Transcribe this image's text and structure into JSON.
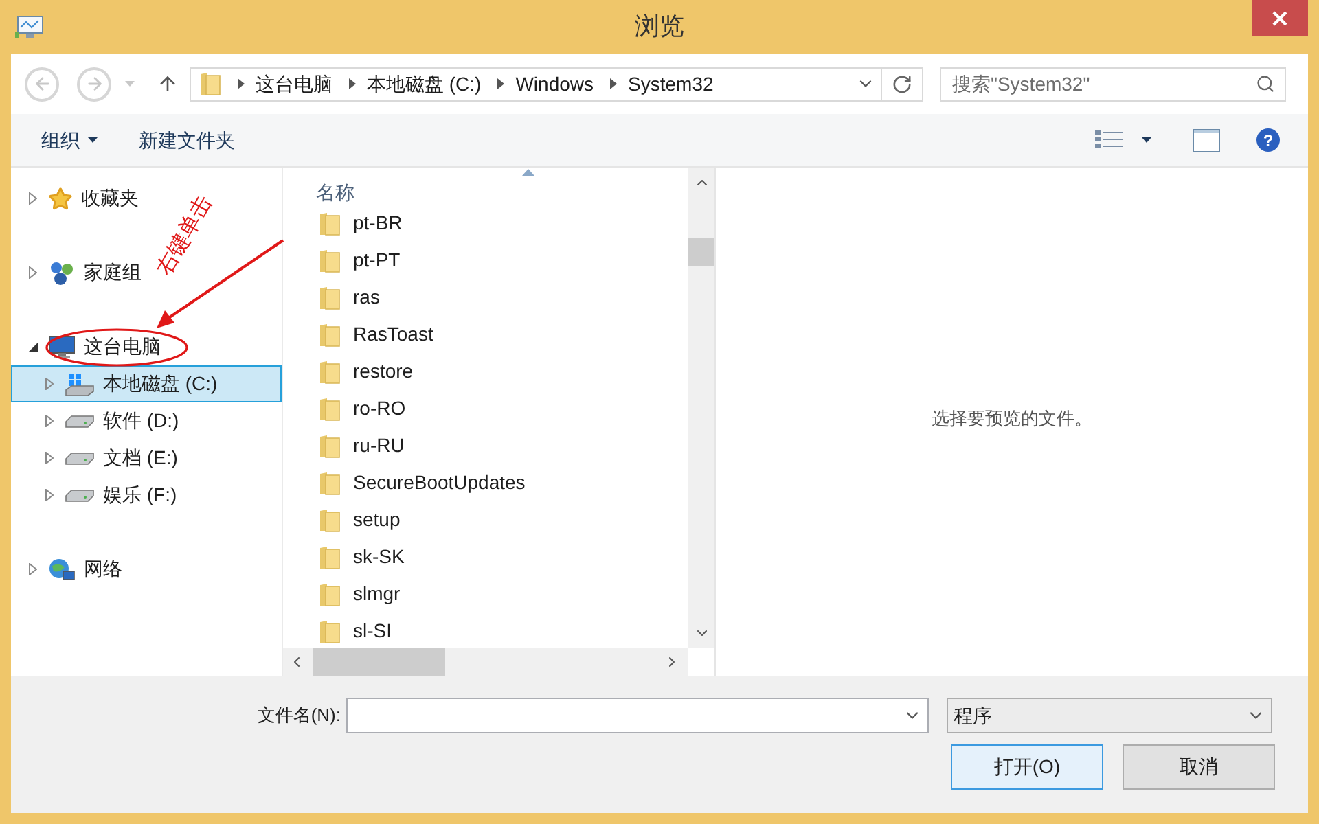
{
  "window": {
    "title": "浏览"
  },
  "navigation": {
    "breadcrumb": [
      "这台电脑",
      "本地磁盘 (C:)",
      "Windows",
      "System32"
    ],
    "search": {
      "placeholder": "搜索\"System32\""
    }
  },
  "toolbar": {
    "organize": "组织",
    "new_folder": "新建文件夹",
    "help": "?"
  },
  "tree": [
    {
      "kind": "favorites",
      "label": "收藏夹",
      "expanded": false,
      "selected": false
    },
    {
      "kind": "homegroup",
      "label": "家庭组",
      "expanded": false,
      "selected": false
    },
    {
      "kind": "computer",
      "label": "这台电脑",
      "expanded": true,
      "selected": false,
      "children": [
        {
          "kind": "system-drive",
          "label": "本地磁盘 (C:)",
          "expanded": false,
          "selected": true
        },
        {
          "kind": "drive",
          "label": "软件 (D:)",
          "expanded": false,
          "selected": false
        },
        {
          "kind": "drive",
          "label": "文档 (E:)",
          "expanded": false,
          "selected": false
        },
        {
          "kind": "drive",
          "label": "娱乐 (F:)",
          "expanded": false,
          "selected": false
        }
      ]
    },
    {
      "kind": "network",
      "label": "网络",
      "expanded": false,
      "selected": false
    }
  ],
  "annotation": {
    "text": "右键单击"
  },
  "file_list": {
    "column_header": "名称",
    "rows": [
      {
        "name": "pt-BR"
      },
      {
        "name": "pt-PT"
      },
      {
        "name": "ras"
      },
      {
        "name": "RasToast"
      },
      {
        "name": "restore"
      },
      {
        "name": "ro-RO"
      },
      {
        "name": "ru-RU"
      },
      {
        "name": "SecureBootUpdates"
      },
      {
        "name": "setup"
      },
      {
        "name": "sk-SK"
      },
      {
        "name": "slmgr"
      },
      {
        "name": "sl-SI"
      }
    ]
  },
  "preview": {
    "message": "选择要预览的文件。"
  },
  "footer": {
    "filename_label": "文件名(N):",
    "file_type": "程序",
    "buttons": [
      {
        "label": "打开(O)",
        "default": true
      },
      {
        "label": "取消",
        "default": false
      }
    ]
  }
}
